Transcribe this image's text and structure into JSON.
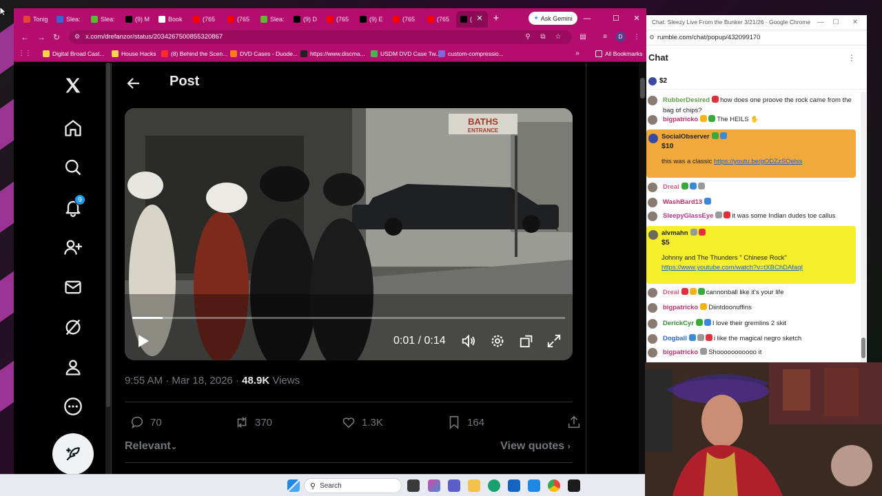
{
  "browser_left": {
    "tabs": [
      {
        "label": "Tonig",
        "icon": "gmail-icon",
        "color": "#ea4335"
      },
      {
        "label": "Slea:",
        "icon": "rumble-r-icon",
        "color": "#3c64d8"
      },
      {
        "label": "Slea:",
        "icon": "rumble-play-icon",
        "color": "#5fb832"
      },
      {
        "label": "(9) M",
        "icon": "x-logo-icon",
        "color": "#000000"
      },
      {
        "label": "Book",
        "icon": "star-icon",
        "color": "#ffffff"
      },
      {
        "label": "(765",
        "icon": "youtube-icon",
        "color": "#ff0000"
      },
      {
        "label": "(765",
        "icon": "youtube-icon",
        "color": "#ff0000"
      },
      {
        "label": "Slea:",
        "icon": "rumble-play-icon",
        "color": "#5fb832"
      },
      {
        "label": "(9) D",
        "icon": "x-logo-icon",
        "color": "#000000"
      },
      {
        "label": "(765",
        "icon": "youtube-icon",
        "color": "#ff0000"
      },
      {
        "label": "(9) E",
        "icon": "x-logo-icon",
        "color": "#000000"
      },
      {
        "label": "(765",
        "icon": "youtube-icon",
        "color": "#ff0000"
      },
      {
        "label": "(765",
        "icon": "youtube-icon",
        "color": "#ff0000"
      },
      {
        "label": "(",
        "icon": "x-logo-icon",
        "color": "#000000"
      }
    ],
    "ask_gemini": "Ask Gemini",
    "url": "x.com/drefanzor/status/2034267500855320867",
    "bookmarks": [
      {
        "label": "Digital Broad Cast...",
        "color": "#ffd54a"
      },
      {
        "label": "House Hacks",
        "color": "#ffd54a"
      },
      {
        "label": "(8) Behind the Scen...",
        "color": "#ff2a2a"
      },
      {
        "label": "DVD Cases - Duode...",
        "color": "#ff7a1a"
      },
      {
        "label": "https://www.discma...",
        "color": "#222222"
      },
      {
        "label": "USDM DVD Case Tw...",
        "color": "#4caf50"
      },
      {
        "label": "custom-compressio...",
        "color": "#7a6ad8"
      }
    ],
    "all_bookmarks": "All Bookmarks",
    "profile_initial": "D",
    "theme_color": "#b30e6e"
  },
  "x_page": {
    "header_title": "Post",
    "notification_count": "9",
    "video": {
      "time_readout": "0:01 / 0:14",
      "progress_fraction": 0.07,
      "sign_line1": "BATHS",
      "sign_line2": "ENTRANCE"
    },
    "meta": {
      "time": "9:55 AM",
      "sep1": "·",
      "date": "Mar 18, 2026",
      "sep2": "·",
      "views_count": "48.9K",
      "views_label": "Views"
    },
    "stats": {
      "replies": "70",
      "reposts": "370",
      "likes": "1.3K",
      "bookmarks": "164"
    },
    "relevant": "Relevant",
    "view_quotes": "View quotes"
  },
  "taskbar": {
    "search_label": "Search"
  },
  "browser_right": {
    "window_title": "Chat: Sleezy Live From the Bunker 3/21/26 - Google Chrome",
    "url": "rumble.com/chat/popup/432099170",
    "chat_title": "Chat",
    "pinned_amount": "$2",
    "messages": [
      {
        "user": "RubberDesired",
        "text": "how does one proove the rock came from the bag of chips?",
        "color": "#5fa04a"
      },
      {
        "user": "bigpatricko",
        "text": "The HEILS ✋",
        "color": "#c0306a"
      },
      {
        "user": "Dreal",
        "text": "",
        "color": "#d45a8a"
      },
      {
        "user": "WashBard13",
        "text": "",
        "color": "#c0306a"
      },
      {
        "user": "SleepyGlassEye",
        "text": "it was some Indian dudes toe callus",
        "color": "#b9348a"
      },
      {
        "user": "Dreal",
        "text": "cannonball like it's your life",
        "color": "#d45a8a"
      },
      {
        "user": "bigpatricko",
        "text": "Diintdoonuffins",
        "color": "#c0306a"
      },
      {
        "user": "DerickCyr",
        "text": "I love their gremlins 2 skit",
        "color": "#3c8a3c"
      },
      {
        "user": "Dogball",
        "text": "i like the magical negro sketch",
        "color": "#2a6ac8"
      },
      {
        "user": "bigpatricko",
        "text": "Shooooooooooo it",
        "color": "#c0306a"
      }
    ],
    "rants": [
      {
        "user": "SocialObserver",
        "amount": "$10",
        "text": "this was a classic ",
        "link": "https://youtu.be/gODZzSOelss",
        "color": "#f2a93b"
      },
      {
        "user": "alvmahn",
        "amount": "$5",
        "text": "Johnny and The Thunders \" Chinese Rock\" ",
        "link": "https://www.youtube.com/watch?v=tXBChDAfaqI",
        "color": "#f5ef2c"
      }
    ]
  }
}
